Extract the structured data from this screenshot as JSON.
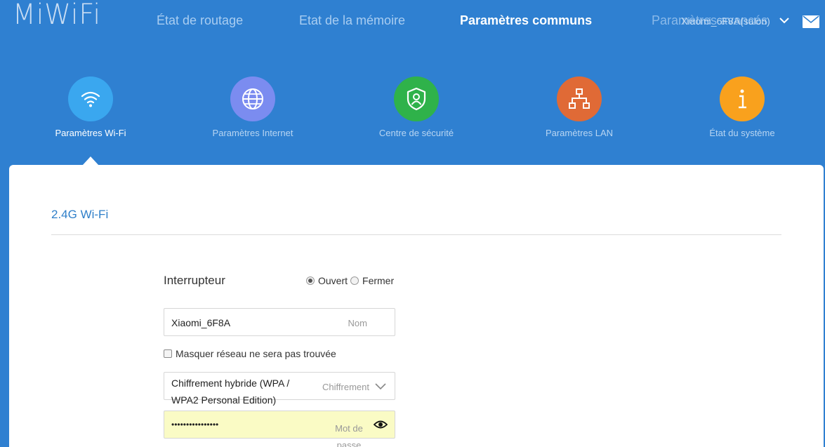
{
  "header": {
    "logo": "MiWiFi",
    "nav": [
      {
        "label": "État de routage",
        "active": false
      },
      {
        "label": "Etat de la mémoire",
        "active": false
      },
      {
        "label": "Paramètres communs",
        "active": true
      },
      {
        "label": "Paramètres avancés",
        "active": false
      }
    ],
    "router_name": "Xiaomi_6F8A(salon)",
    "icons": {
      "dropdown": "chevron-down-icon",
      "mail": "mail-icon"
    }
  },
  "categories": [
    {
      "label": "Paramètres Wi-Fi",
      "icon": "wifi-icon",
      "color": "#3aa7ef",
      "active": true
    },
    {
      "label": "Paramètres Internet",
      "icon": "globe-icon",
      "color": "#7b8cf0",
      "active": false
    },
    {
      "label": "Centre de sécurité",
      "icon": "shield-user-icon",
      "color": "#2fb24a",
      "active": false
    },
    {
      "label": "Paramètres LAN",
      "icon": "network-icon",
      "color": "#e06a36",
      "active": false
    },
    {
      "label": "État du système",
      "icon": "info-icon",
      "color": "#f9a11d",
      "active": false
    }
  ],
  "wifi24": {
    "section_title": "2.4G Wi-Fi",
    "switch": {
      "label": "Interrupteur",
      "options": [
        {
          "label": "Ouvert",
          "checked": true
        },
        {
          "label": "Fermer",
          "checked": false
        }
      ]
    },
    "name": {
      "value": "Xiaomi_6F8A",
      "placeholder": "Nom"
    },
    "hide_network": {
      "label": "Masquer réseau ne sera pas trouvée",
      "checked": false
    },
    "encryption": {
      "value": "Chiffrement hybride (WPA / WPA2 Personal Edition)",
      "placeholder": "Chiffrement"
    },
    "password": {
      "value": "••••••••••••••••",
      "placeholder": "Mot de passe",
      "icon": "eye-icon"
    }
  }
}
